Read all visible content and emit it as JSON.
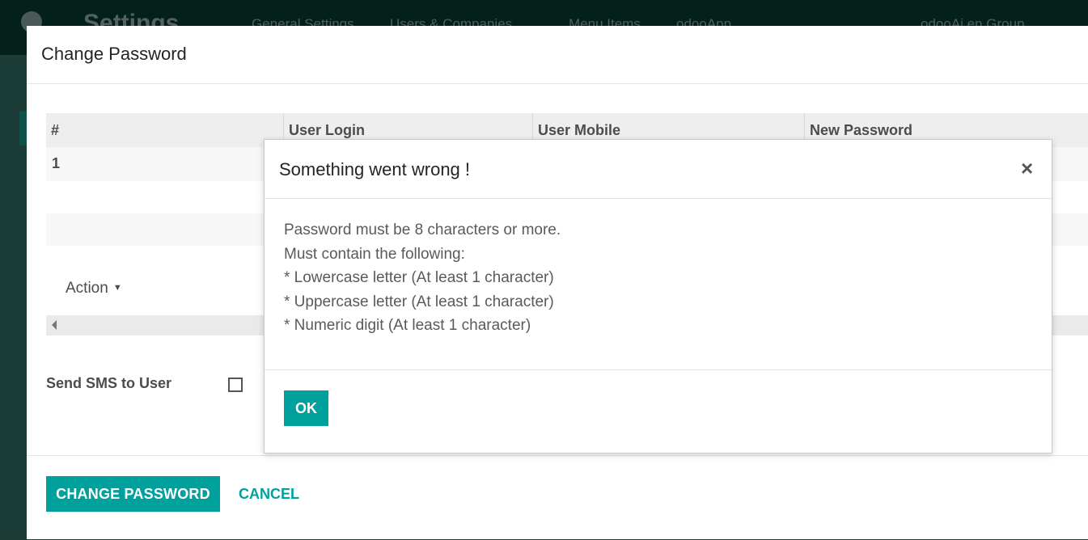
{
  "background": {
    "app_title": "Settings",
    "nav": [
      "General Settings",
      "Users & Companies",
      "Menu Items",
      "odooApp"
    ],
    "user": "odooAi.en Group"
  },
  "modal": {
    "title": "Change Password",
    "table": {
      "headers": [
        "#",
        "User Login",
        "User Mobile",
        "New Password"
      ],
      "rows": [
        [
          "1",
          "",
          "",
          ""
        ]
      ]
    },
    "action_label": "Action",
    "send_sms_label": "Send SMS to User",
    "send_sms_checked": false,
    "primary_button": "CHANGE PASSWORD",
    "cancel_button": "CANCEL"
  },
  "error_dialog": {
    "title": "Something went wrong !",
    "close_glyph": "×",
    "lines": [
      "Password must be 8 characters or more.",
      "Must contain the following:",
      "* Lowercase letter (At least 1 character)",
      "* Uppercase letter (At least 1 character)",
      "* Numeric digit (At least 1 character)"
    ],
    "ok_button": "OK"
  },
  "colors": {
    "accent": "#00a09d",
    "topbar": "#03201b"
  }
}
